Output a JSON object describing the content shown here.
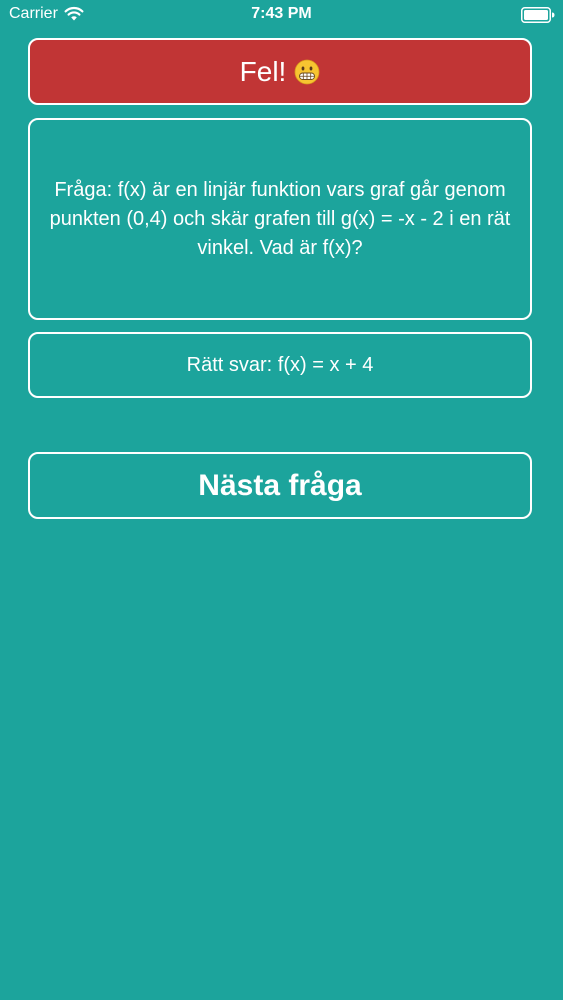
{
  "status_bar": {
    "carrier": "Carrier",
    "time": "7:43 PM"
  },
  "feedback": {
    "label": "Fel!",
    "emoji_icon": "grimacing-face-icon"
  },
  "question": {
    "text": "Fråga: f(x) är en linjär funktion vars graf går genom punkten (0,4) och skär grafen till g(x) = -x - 2 i en rät vinkel. Vad är f(x)?"
  },
  "answer": {
    "text": "Rätt svar: f(x) = x + 4"
  },
  "next_button": {
    "label": "Nästa fråga"
  },
  "colors": {
    "background": "#1ca49c",
    "error_banner": "#c13535",
    "text": "#ffffff"
  }
}
